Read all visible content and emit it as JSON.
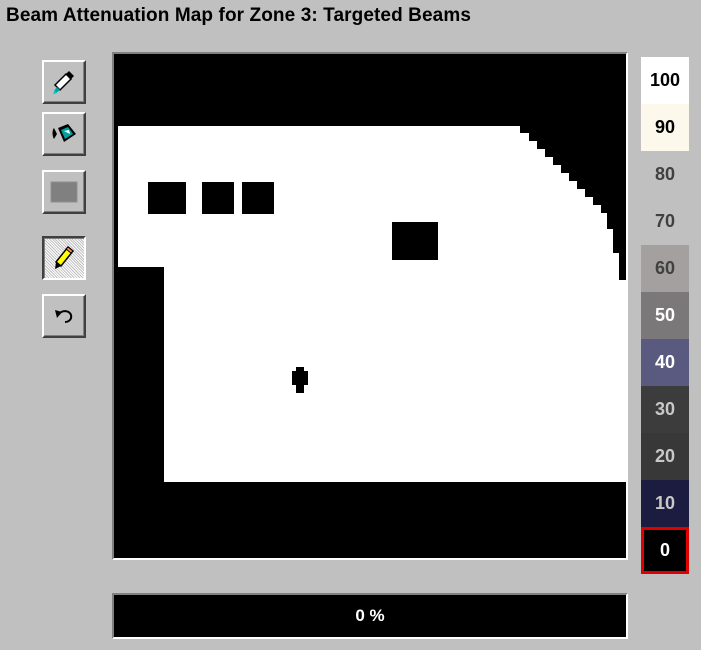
{
  "title": "Beam Attenuation Map for Zone 3: Targeted Beams",
  "tools": [
    {
      "name": "eyedropper-icon",
      "pressed": false
    },
    {
      "name": "paint-bucket-icon",
      "pressed": false
    },
    {
      "name": "rectangle-icon",
      "pressed": false
    },
    {
      "name": "pencil-icon",
      "pressed": true
    },
    {
      "name": "undo-icon",
      "pressed": false
    }
  ],
  "scale": [
    {
      "label": "100",
      "bg": "#ffffff",
      "fg": "#000000"
    },
    {
      "label": "90",
      "bg": "#fcf8ec",
      "fg": "#000000"
    },
    {
      "label": "80",
      "bg": "#c0c0c0",
      "fg": "#404040"
    },
    {
      "label": "70",
      "bg": "#c0c0c0",
      "fg": "#404040"
    },
    {
      "label": "60",
      "bg": "#a4a0a0",
      "fg": "#404040"
    },
    {
      "label": "50",
      "bg": "#7a7878",
      "fg": "#ffffff"
    },
    {
      "label": "40",
      "bg": "#5a5a80",
      "fg": "#ffffff"
    },
    {
      "label": "30",
      "bg": "#3c3c3c",
      "fg": "#c8c8c8"
    },
    {
      "label": "20",
      "bg": "#383838",
      "fg": "#c8c8c8"
    },
    {
      "label": "10",
      "bg": "#1c1c40",
      "fg": "#c8c8c8"
    },
    {
      "label": "0",
      "bg": "#000000",
      "fg": "#ffffff"
    }
  ],
  "selected_level": "0",
  "progress_text": "0 %"
}
